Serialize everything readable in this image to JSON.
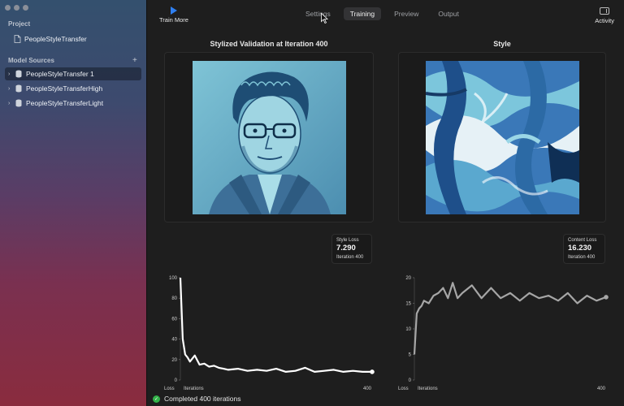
{
  "sidebar": {
    "project_heading": "Project",
    "project_item": "PeopleStyleTransfer",
    "sources_heading": "Model Sources",
    "add_symbol": "+",
    "sources": [
      {
        "label": "PeopleStyleTransfer 1",
        "selected": true
      },
      {
        "label": "PeopleStyleTransferHigh",
        "selected": false
      },
      {
        "label": "PeopleStyleTransferLight",
        "selected": false
      }
    ]
  },
  "toolbar": {
    "train_more": "Train More",
    "tabs": [
      "Settings",
      "Training",
      "Preview",
      "Output"
    ],
    "active_tab": "Training",
    "activity": "Activity"
  },
  "panels": {
    "validation_title": "Stylized Validation at Iteration 400",
    "style_title": "Style"
  },
  "style_loss": {
    "label": "Style Loss",
    "value": "7.290",
    "iteration": "Iteration 400"
  },
  "content_loss": {
    "label": "Content Loss",
    "value": "16.230",
    "iteration": "Iteration 400"
  },
  "status": {
    "text": "Completed 400 iterations",
    "color": "#33b249"
  },
  "chart_data": [
    {
      "type": "line",
      "xlabel": "Iterations",
      "ylabel": "Loss",
      "x_ticks": [
        "400"
      ],
      "y_ticks": [
        "100",
        "80",
        "60",
        "40",
        "20",
        "0"
      ],
      "xlim": [
        0,
        400
      ],
      "ylim": [
        0,
        100
      ],
      "grid": false,
      "x": [
        0,
        5,
        10,
        15,
        20,
        30,
        40,
        50,
        60,
        70,
        80,
        90,
        100,
        120,
        140,
        160,
        180,
        200,
        220,
        240,
        260,
        280,
        300,
        320,
        340,
        360,
        380,
        400
      ],
      "values": [
        100,
        40,
        25,
        22,
        18,
        24,
        15,
        16,
        13,
        14,
        12,
        11,
        10,
        11,
        9,
        10,
        9,
        11,
        8,
        9,
        12,
        8,
        9,
        10,
        8,
        9,
        8,
        8
      ]
    },
    {
      "type": "line",
      "xlabel": "Iterations",
      "ylabel": "Loss",
      "x_ticks": [
        "400"
      ],
      "y_ticks": [
        "20",
        "15",
        "10",
        "5",
        "0"
      ],
      "xlim": [
        0,
        400
      ],
      "ylim": [
        0,
        20
      ],
      "grid": false,
      "x": [
        0,
        5,
        10,
        15,
        20,
        30,
        40,
        50,
        60,
        70,
        80,
        90,
        100,
        120,
        140,
        160,
        180,
        200,
        220,
        240,
        260,
        280,
        300,
        320,
        340,
        360,
        380,
        400
      ],
      "values": [
        5,
        13,
        14,
        14.5,
        15.5,
        15,
        16.5,
        17,
        18,
        16,
        19,
        16,
        17,
        18.5,
        16,
        18,
        16,
        17,
        15.5,
        17,
        16,
        16.5,
        15.5,
        17,
        15,
        16.5,
        15.5,
        16.2
      ]
    }
  ]
}
